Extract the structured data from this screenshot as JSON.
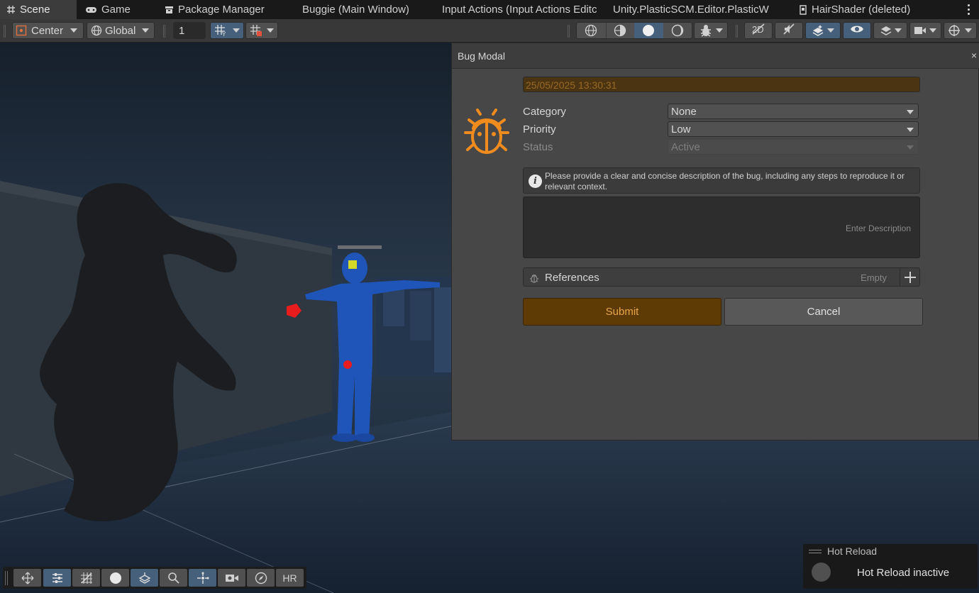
{
  "tabs": [
    {
      "label": "Scene",
      "icon": "grid-icon",
      "active": true
    },
    {
      "label": "Game",
      "icon": "gamepad-icon"
    },
    {
      "label": "Package Manager",
      "icon": "package-icon"
    },
    {
      "label": "Buggie (Main Window)"
    },
    {
      "label": "Input Actions (Input Actions Editc"
    },
    {
      "label": "Unity.PlasticSCM.Editor.PlasticW"
    },
    {
      "label": "HairShader (deleted)",
      "icon": "shader-icon"
    }
  ],
  "toolbar": {
    "pivot_mode": "Center",
    "pivot_rotation": "Global",
    "grid_snap_value": "1"
  },
  "modal": {
    "title": "Bug Modal",
    "close": "×",
    "timestamp": "25/05/2025 13:30:31",
    "fields": {
      "category": {
        "label": "Category",
        "value": "None"
      },
      "priority": {
        "label": "Priority",
        "value": "Low"
      },
      "status": {
        "label": "Status",
        "value": "Active"
      }
    },
    "help_text": "Please provide a clear and concise description of the bug, including any steps to reproduce it or relevant context.",
    "description_placeholder": "Enter Description",
    "references": {
      "label": "References",
      "count_text": "Empty"
    },
    "submit_label": "Submit",
    "cancel_label": "Cancel",
    "accent_color": "#f08c1e"
  },
  "overlay_toolbar": {
    "hr_label": "HR"
  },
  "hot_reload": {
    "title": "Hot Reload",
    "status": "Hot Reload inactive"
  }
}
